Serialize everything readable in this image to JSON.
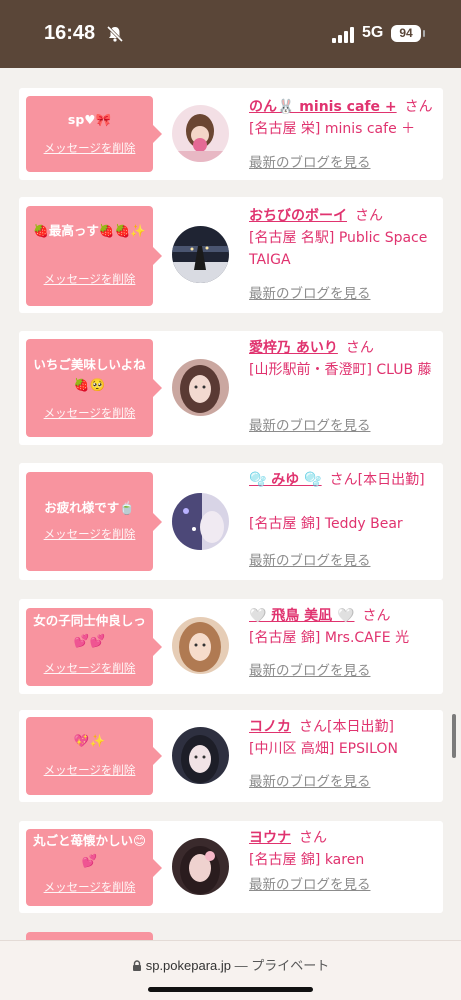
{
  "status_bar": {
    "time": "16:48",
    "network": "5G",
    "battery": "94"
  },
  "cards": [
    {
      "message": "sp♥🎀",
      "delete_label": "メッセージを削除",
      "name": "のん🐰 minis cafe +",
      "honorific": "さん",
      "shop": "[名古屋 栄] minis cafe ＋",
      "blog_label": "最新のブログを見る",
      "avatar_color": "#e8b8c4"
    },
    {
      "message": "🍓最高っす🍓🍓✨",
      "delete_label": "メッセージを削除",
      "name": "おちびのボーイ",
      "honorific": "さん",
      "shop": "[名古屋 名駅] Public Space TAIGA",
      "blog_label": "最新のブログを見る",
      "avatar_color": "#2a2e3c"
    },
    {
      "message": "いちご美味しいよね🍓🥺",
      "delete_label": "メッセージを削除",
      "name": "愛梓乃 あいり",
      "honorific": "さん",
      "shop": "[山形駅前・香澄町] CLUB 藤",
      "blog_label": "最新のブログを見る",
      "avatar_color": "#b98a86"
    },
    {
      "message": "お疲れ様です🍵",
      "delete_label": "メッセージを削除",
      "name": "🫧 みゆ 🫧",
      "honorific": "さん[本日出勤]",
      "shop": "[名古屋 錦] Teddy Bear",
      "blog_label": "最新のブログを見る",
      "avatar_color": "#6e6a9c"
    },
    {
      "message": "女の子同士仲良しっ💕💕",
      "delete_label": "メッセージを削除",
      "name": "🤍 飛鳥 美凪 🤍",
      "honorific": "さん",
      "shop": "[名古屋 錦] Mrs.CAFE 光",
      "blog_label": "最新のブログを見る",
      "avatar_color": "#c59a7a"
    },
    {
      "message": "💖✨",
      "delete_label": "メッセージを削除",
      "name": "コノカ",
      "honorific": "さん[本日出勤]",
      "shop": "[中川区 高畑] EPSILON",
      "blog_label": "最新のブログを見る",
      "avatar_color": "#3c3e4e"
    },
    {
      "message": "丸ごと苺懐かしい😊💕",
      "delete_label": "メッセージを削除",
      "name": "ヨウナ",
      "honorific": "さん",
      "shop": "[名古屋 錦] karen",
      "blog_label": "最新のブログを見る",
      "avatar_color": "#4a2c30"
    }
  ],
  "browser": {
    "domain": "sp.pokepara.jp",
    "separator": "—",
    "mode": "プライベート"
  }
}
